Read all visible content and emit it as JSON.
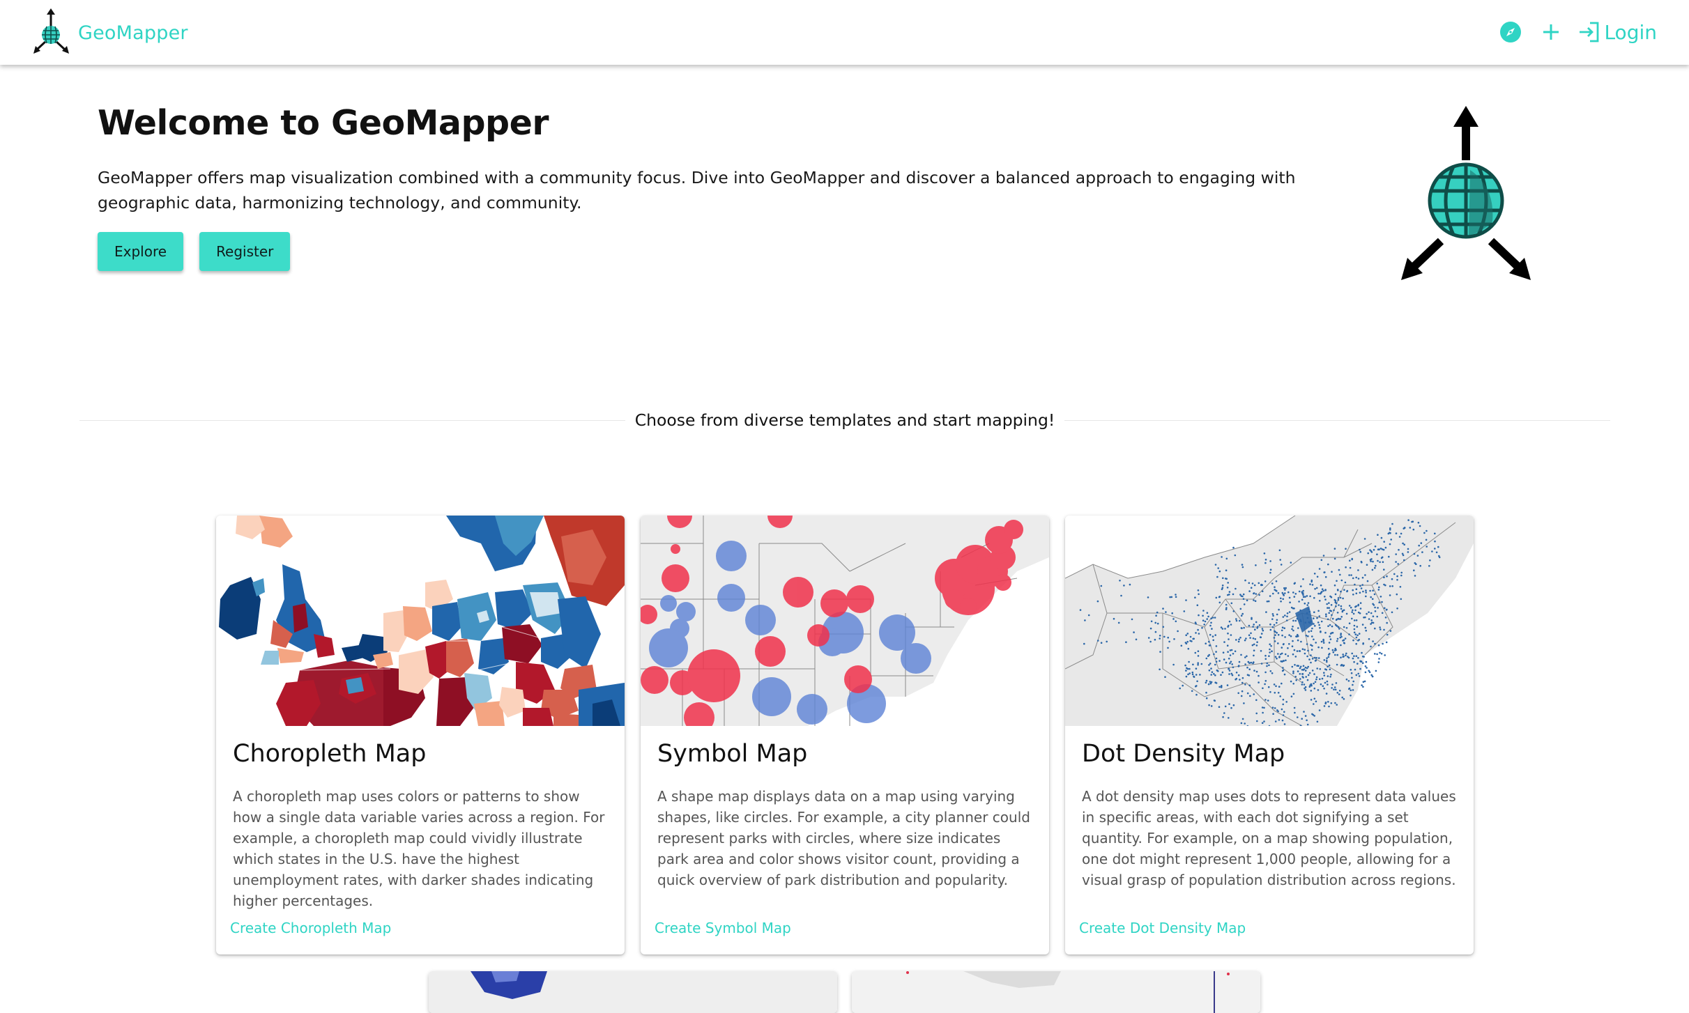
{
  "header": {
    "brand": "GeoMapper",
    "login_label": "Login",
    "icons": [
      "compass-icon",
      "plus-icon",
      "login-icon"
    ]
  },
  "hero": {
    "title": "Welcome to GeoMapper",
    "description": "GeoMapper offers map visualization combined with a community focus. Dive into GeoMapper and discover a balanced approach to engaging with geographic data, harmonizing technology, and community.",
    "explore_label": "Explore",
    "register_label": "Register"
  },
  "divider": {
    "text": "Choose from diverse templates and start mapping!"
  },
  "templates": [
    {
      "title": "Choropleth Map",
      "description": "A choropleth map uses colors or patterns to show how a single data variable varies across a region. For example, a choropleth map could vividly illustrate which states in the U.S. have the highest unemployment rates, with darker shades indicating higher percentages.",
      "link": "Create Choropleth Map"
    },
    {
      "title": "Symbol Map",
      "description": "A shape map displays data on a map using varying shapes, like circles. For example, a city planner could represent parks with circles, where size indicates park area and color shows visitor count, providing a quick overview of park distribution and popularity.",
      "link": "Create Symbol Map"
    },
    {
      "title": "Dot Density Map",
      "description": "A dot density map uses dots to represent data values in specific areas, with each dot signifying a set quantity. For example, on a map showing population, one dot might represent 1,000 people, allowing for a visual grasp of population distribution across regions.",
      "link": "Create Dot Density Map"
    }
  ],
  "colors": {
    "accent": "#2fd4c4",
    "button": "#3ddcc9",
    "globe_dark": "#1a6b66",
    "choropleth_dark_red": "#8e0f24",
    "choropleth_dark_blue": "#0c3d7a",
    "symbol_red": "#f0324c",
    "symbol_blue": "#5d83d6",
    "dot_blue": "#2a66a8"
  }
}
